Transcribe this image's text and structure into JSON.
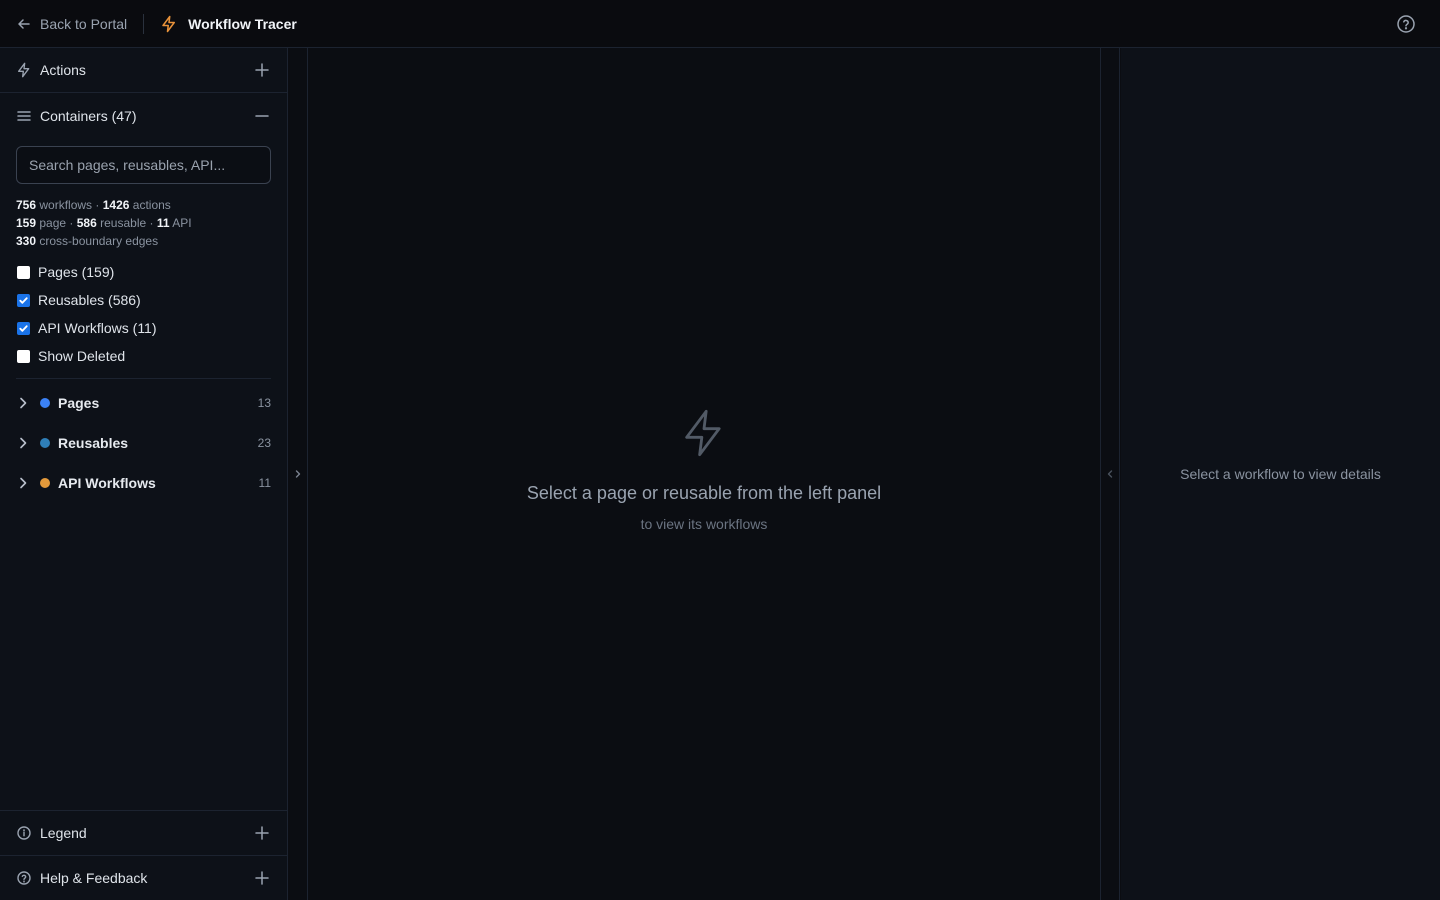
{
  "topbar": {
    "back_label": "Back to Portal",
    "app_title": "Workflow Tracer",
    "accent": "#e8923a"
  },
  "sidebar": {
    "actions_label": "Actions",
    "containers_label": "Containers (47)",
    "search": {
      "placeholder": "Search pages, reusables, API..."
    },
    "stats": {
      "workflows": "756",
      "workflows_label": "workflows",
      "actions": "1426",
      "actions_label": "actions",
      "page": "159",
      "page_label": "page",
      "reusable": "586",
      "reusable_label": "reusable",
      "api": "11",
      "api_label": "API",
      "edges": "330",
      "edges_label": "cross-boundary edges"
    },
    "filters": [
      {
        "label": "Pages (159)",
        "checked": false
      },
      {
        "label": "Reusables (586)",
        "checked": true
      },
      {
        "label": "API Workflows (11)",
        "checked": true
      },
      {
        "label": "Show Deleted",
        "checked": false
      }
    ],
    "groups": [
      {
        "label": "Pages",
        "count": "13",
        "color": "#3b82f6"
      },
      {
        "label": "Reusables",
        "count": "23",
        "color": "#2f7fb8"
      },
      {
        "label": "API Workflows",
        "count": "11",
        "color": "#e39a3b"
      }
    ],
    "legend_label": "Legend",
    "help_label": "Help & Feedback"
  },
  "main": {
    "empty_title": "Select a page or reusable from the left panel",
    "empty_sub": "to view its workflows"
  },
  "details": {
    "empty": "Select a workflow to view details"
  }
}
